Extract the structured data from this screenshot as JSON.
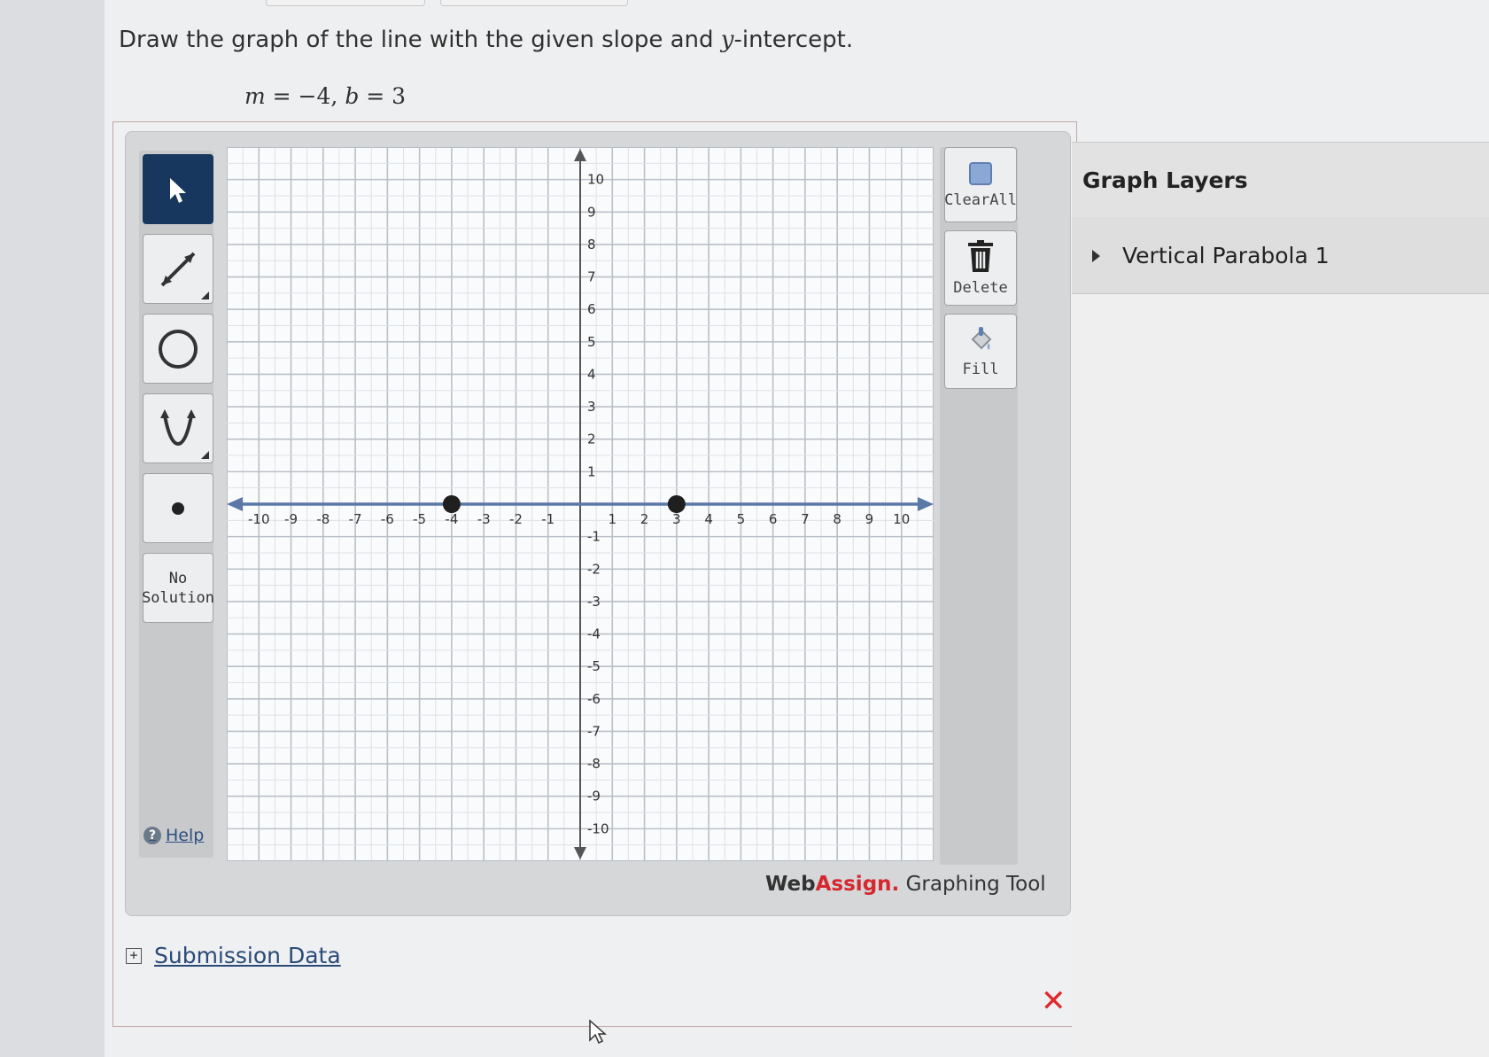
{
  "question": {
    "text_before": "Draw the graph of the line with the given slope and ",
    "variable": "y",
    "text_after": "-intercept."
  },
  "equation": {
    "m_var": "m",
    "m_value": " = −4, ",
    "b_var": "b",
    "b_value": " = 3"
  },
  "toolbar": {
    "no_solution_line1": "No",
    "no_solution_line2": "Solution",
    "help_icon": "?",
    "help_label": "Help"
  },
  "actions": {
    "clear_all_label": "ClearAll",
    "delete_label": "Delete",
    "fill_label": "Fill"
  },
  "brand": {
    "part1": "Web",
    "part2": "Assign.",
    "part3": " Graphing Tool"
  },
  "submission": {
    "plus": "+",
    "label": "Submission Data"
  },
  "status": {
    "wrong_mark": "✕"
  },
  "layers": {
    "title": "Graph Layers",
    "items": [
      {
        "label": "Vertical Parabola 1"
      }
    ]
  },
  "colors": {
    "accent_active": "#17375e",
    "line": "#5b78a8",
    "wrong": "#e0282a",
    "brand_accent": "#d6262e"
  },
  "chart_data": {
    "type": "scatter",
    "xlim": [
      -11,
      11
    ],
    "ylim": [
      -11,
      11
    ],
    "x_ticks": [
      -10,
      -9,
      -8,
      -7,
      -6,
      -5,
      -4,
      -3,
      -2,
      -1,
      1,
      2,
      3,
      4,
      5,
      6,
      7,
      8,
      9,
      10
    ],
    "y_ticks": [
      10,
      9,
      8,
      7,
      6,
      5,
      4,
      3,
      2,
      1,
      -1,
      -2,
      -3,
      -4,
      -5,
      -6,
      -7,
      -8,
      -9,
      -10
    ],
    "grid": true,
    "series": [
      {
        "type": "line",
        "points": [
          {
            "x": -4,
            "y": 0
          },
          {
            "x": 3,
            "y": 0
          }
        ]
      }
    ]
  }
}
